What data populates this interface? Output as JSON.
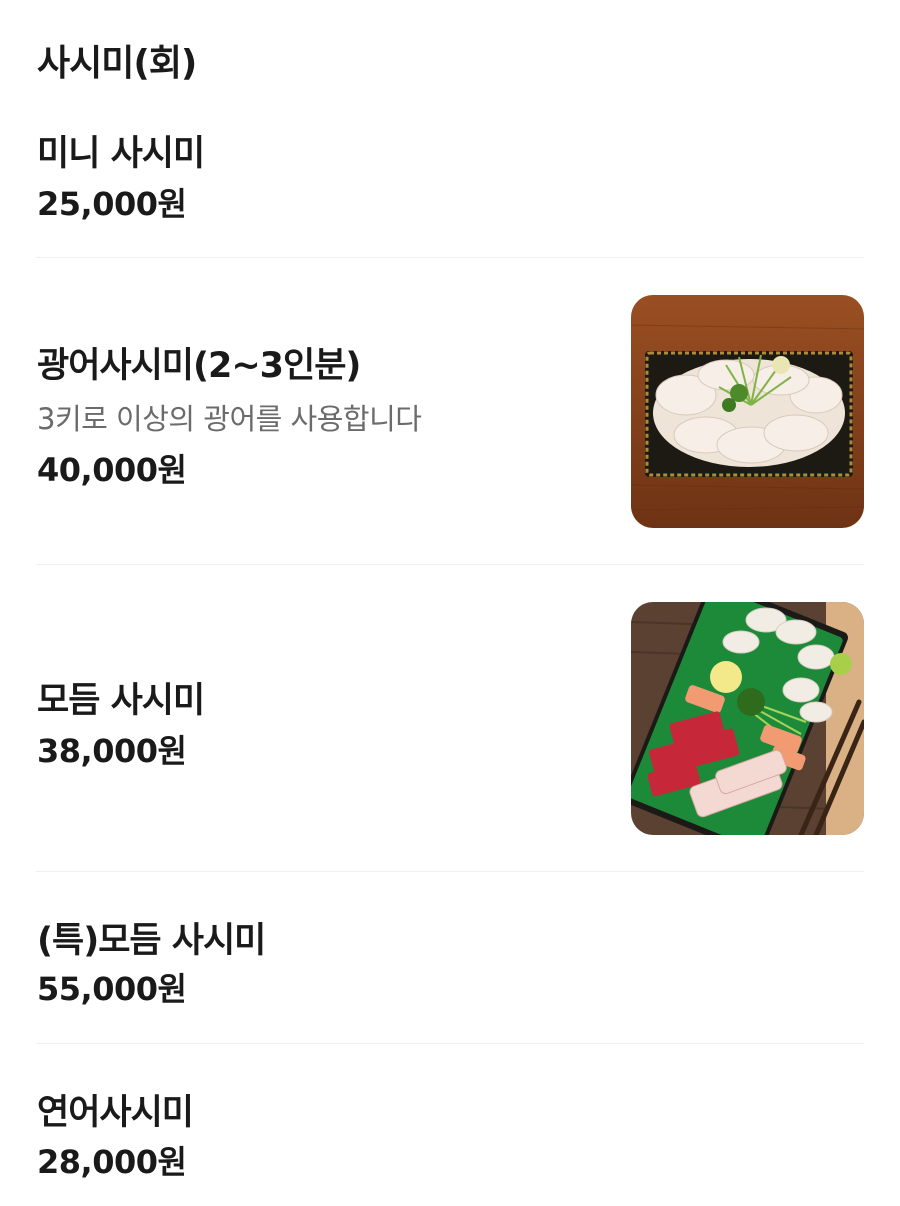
{
  "section": {
    "title": "사시미(회)"
  },
  "items": [
    {
      "name": "미니 사시미",
      "description": "",
      "price": "25,000원"
    },
    {
      "name": "광어사시미(2~3인분)",
      "description": "3키로 이상의 광어를 사용합니다",
      "price": "40,000원",
      "photo": "flatfish-sashimi-platter"
    },
    {
      "name": "모듬 사시미",
      "description": "",
      "price": "38,000원",
      "photo": "assorted-sashimi-platter"
    },
    {
      "name": "(특)모듬 사시미",
      "description": "",
      "price": "55,000원"
    },
    {
      "name": "연어사시미",
      "description": "",
      "price": "28,000원"
    }
  ],
  "colors": {
    "text": "#1a1a1a",
    "description": "#6b6b6b",
    "divider": "#efefef"
  }
}
